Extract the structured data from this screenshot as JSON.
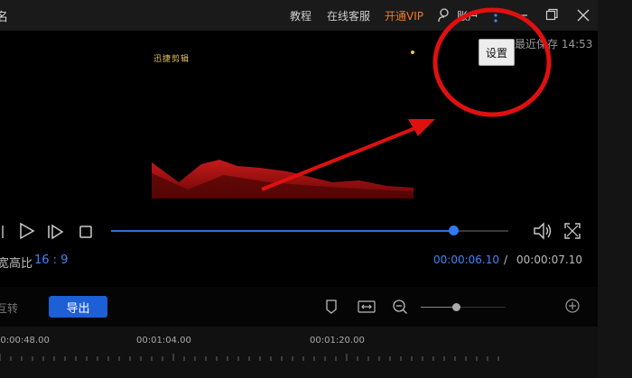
{
  "titlebar": {
    "title_fragment": "名",
    "menu": {
      "tutorial": "教程",
      "support": "在线客服",
      "vip": "开通VIP",
      "account": "账户"
    },
    "icons": [
      "user-icon",
      "more-icon",
      "minimize-icon",
      "restore-icon",
      "close-icon"
    ]
  },
  "preview": {
    "save_status": "最近保存 14:53",
    "tooltip": "设置",
    "logo_text": "迅捷剪辑"
  },
  "controls": {
    "progress_fraction": 0.8526,
    "aspect_ratio_label": "宽高比",
    "aspect_ratio_value": "16 : 9",
    "current_time": "00:00:06.10",
    "time_separator": "/",
    "total_time": "00:00:07.10"
  },
  "toolbar": {
    "partial_label": "互转",
    "export_label": "导出",
    "zoom_fraction": 0.4
  },
  "timeline": {
    "ticks": [
      "00:00:48.00",
      "00:01:04.00",
      "00:01:20.00"
    ]
  },
  "colors": {
    "accent": "#2f7af0",
    "vip": "#f07b2a",
    "annotation": "#e01010"
  }
}
